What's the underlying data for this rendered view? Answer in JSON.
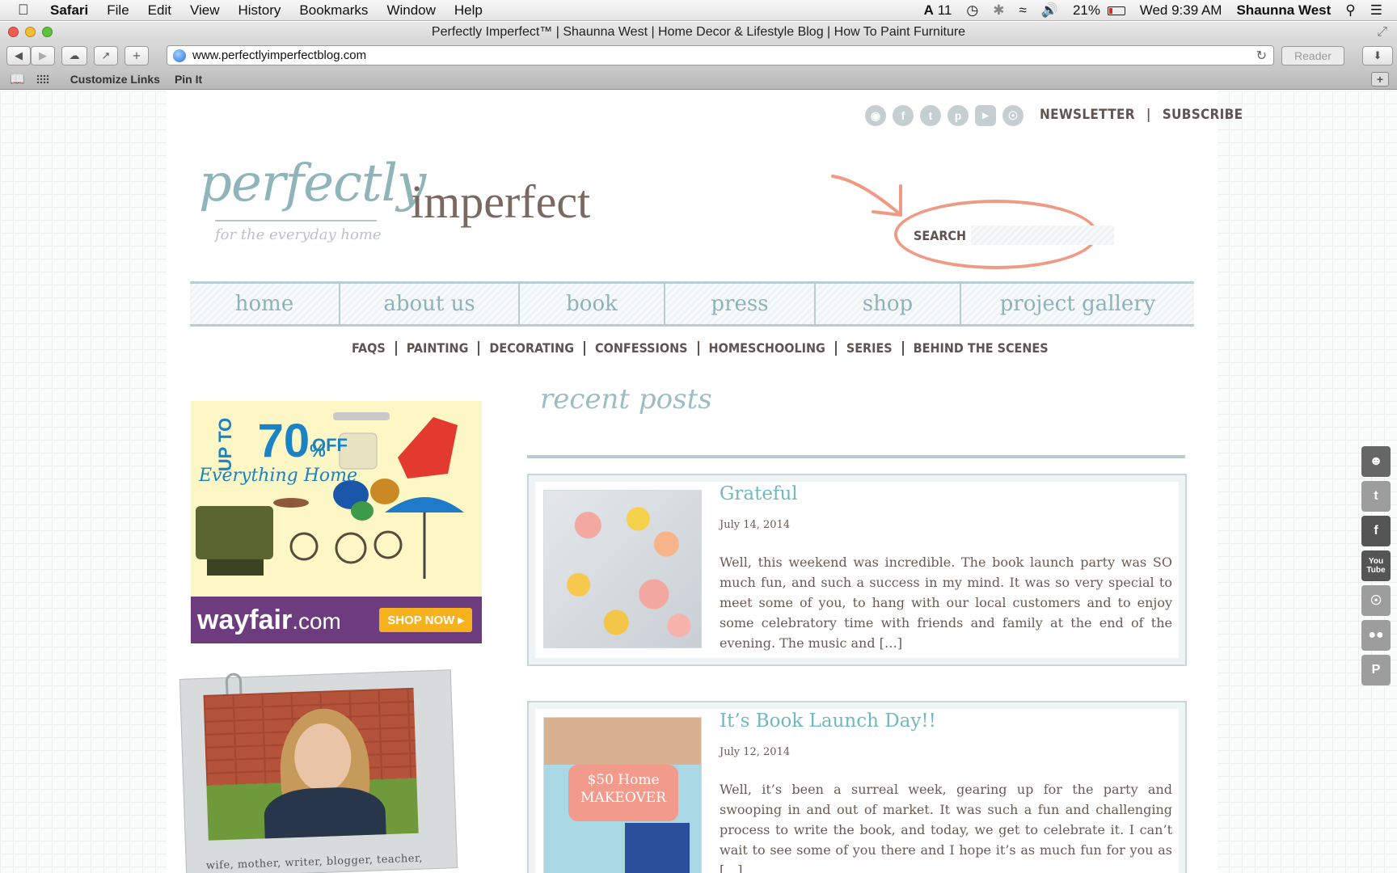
{
  "menubar": {
    "app": "Safari",
    "items": [
      "File",
      "Edit",
      "View",
      "History",
      "Bookmarks",
      "Window",
      "Help"
    ],
    "status": {
      "adobe": "11",
      "battery": "21%",
      "clock": "Wed 9:39 AM",
      "user": "Shaunna West"
    }
  },
  "window": {
    "title": "Perfectly Imperfect™ | Shaunna West | Home Decor & Lifestyle Blog | How To Paint Furniture"
  },
  "toolbar": {
    "url": "www.perfectlyimperfectblog.com",
    "reader": "Reader"
  },
  "bookmarks": {
    "items": [
      "Customize Links",
      "Pin It"
    ]
  },
  "site": {
    "social": [
      "instagram-icon",
      "facebook-icon",
      "twitter-icon",
      "pinterest-icon",
      "youtube-icon",
      "rss-icon"
    ],
    "top_links": [
      "NEWSLETTER",
      "SUBSCRIBE"
    ],
    "logo": {
      "script": "perfectly",
      "serif": "imperfect",
      "tagline": "for the everyday home"
    },
    "search": {
      "label": "SEARCH",
      "placeholder": ""
    },
    "nav": [
      "home",
      "about us",
      "book",
      "press",
      "shop",
      "project gallery"
    ],
    "subnav": [
      "FAQS",
      "PAINTING",
      "DECORATING",
      "CONFESSIONS",
      "HOMESCHOOLING",
      "SERIES",
      "BEHIND THE SCENES"
    ],
    "ad": {
      "upto": "UP TO",
      "percent": "70",
      "off": "OFF",
      "tagline": "Everything Home",
      "brand": "wayfair",
      "brand_suffix": ".com",
      "cta": "SHOP NOW ▸"
    },
    "profile_caption": "wife, mother, writer, blogger, teacher,",
    "recent_posts_heading": "recent posts",
    "posts": [
      {
        "title": "Grateful",
        "date": "July 14, 2014",
        "excerpt": "Well, this weekend was incredible. The book launch party was SO much fun, and such a success in my mind.  It was so very special to meet some of you, to hang with our local customers and to enjoy some celebratory time with friends and family at the end of the evening. The music and […]"
      },
      {
        "title": "It’s Book Launch Day!!",
        "date": "July 12, 2014",
        "excerpt": "Well, it’s been a surreal week, gearing up for the party and swooping in and out of market.  It was such a fun and challenging process to write the book, and today, we get to celebrate it. I can’t wait to see some of you there and I hope it’s as much fun for you as […]",
        "thumb_text": "$50 Home MAKEOVER"
      }
    ],
    "share_bar": [
      "contact-icon",
      "twitter-icon",
      "facebook-icon",
      "youtube-icon",
      "rss-icon",
      "flickr-icon",
      "pinterest-icon"
    ],
    "share_text": {
      "youtube": "You Tube",
      "facebook": "f",
      "pinterest": "P"
    }
  },
  "colors": {
    "accent": "#8fb5bb",
    "nav_text": "#8fb2b8",
    "body_text": "#6a5a52",
    "annotation": "#ee9a84",
    "wayfair_purple": "#6d3c7e"
  }
}
